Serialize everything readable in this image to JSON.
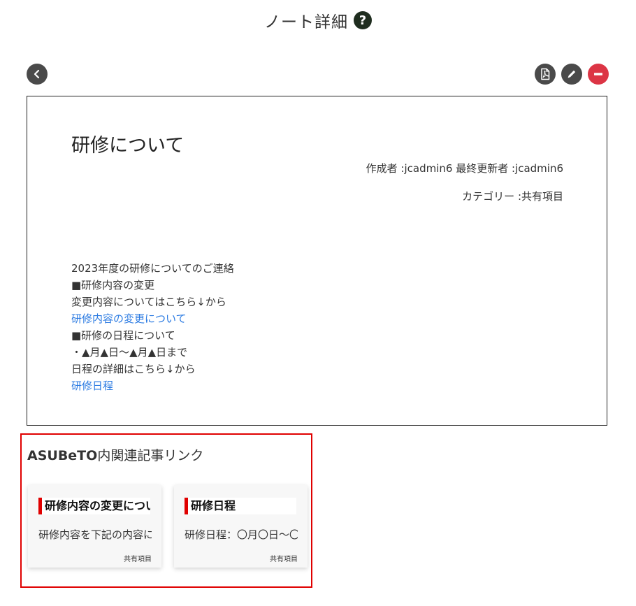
{
  "header": {
    "title": "ノート詳細",
    "help_icon": "?"
  },
  "toolbar": {
    "back_icon": "chevron-left-icon",
    "pdf_icon": "pdf-file-icon",
    "edit_icon": "pencil-icon",
    "delete_icon": "minus-icon",
    "delete_color": "#dc3545",
    "button_color": "#4a4a4a"
  },
  "note": {
    "title": "研修について",
    "authors": "作成者 :jcadmin6 最終更新者 :jcadmin6",
    "category": "カテゴリー :共有項目",
    "body": [
      {
        "text": "2023年度の研修についてのご連絡",
        "link": false
      },
      {
        "text": "■研修内容の変更",
        "link": false
      },
      {
        "text": "変更内容についてはこちら↓から",
        "link": false
      },
      {
        "text": "研修内容の変更について",
        "link": true
      },
      {
        "text": "■研修の日程について",
        "link": false
      },
      {
        "text": "・▲月▲日～▲月▲日まで",
        "link": false
      },
      {
        "text": "日程の詳細はこちら↓から",
        "link": false
      },
      {
        "text": "研修日程",
        "link": true
      }
    ],
    "link_color": "#2a7ae2"
  },
  "related": {
    "heading_bold": "ASUBeTO",
    "heading_rest": "内関連記事リンク",
    "highlight_color": "#e00000",
    "cards": [
      {
        "title": "研修内容の変更について",
        "excerpt": "研修内容を下記の内容に変更します",
        "category": "共有項目"
      },
      {
        "title": "研修日程",
        "excerpt": "研修日程：〇月〇日～〇月〇日",
        "category": "共有項目"
      }
    ]
  }
}
